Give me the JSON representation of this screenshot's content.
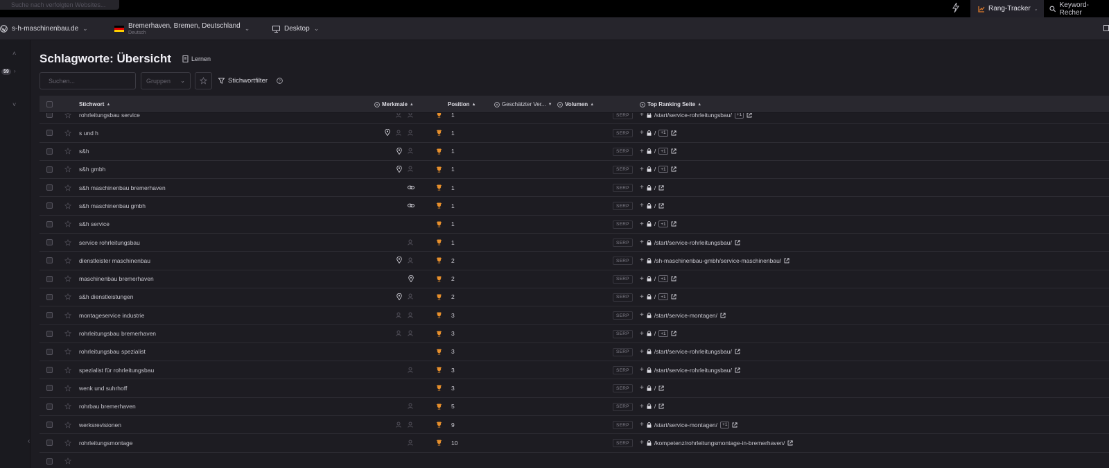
{
  "topbar": {
    "search_placeholder": "Suche nach verfolgten Websites...",
    "active_tab": "Rang-Tracker",
    "next_tab": "Keyword-Recher"
  },
  "project": {
    "domain": "s-h-maschinenbau.de",
    "location": "Bremerhaven, Bremen, Deutschland",
    "language": "Deutsch",
    "device": "Desktop"
  },
  "sidebar": {
    "badge": "59"
  },
  "page": {
    "title": "Schlagworte: Übersicht",
    "learn": "Lernen",
    "search_placeholder": "Suchen...",
    "groups_placeholder": "Gruppen",
    "keyword_filter": "Stichwortfilter"
  },
  "columns": {
    "keyword": "Stichwort",
    "features": "Merkmale",
    "position": "Position",
    "traffic": "Geschätzter Ver...",
    "volume": "Volumen",
    "top_page": "Top Ranking Seite"
  },
  "serp_label": "SERP",
  "plus_one_label": "+1",
  "colors": {
    "accent": "#e07b2a",
    "trophy": "#e8902c"
  },
  "rows": [
    {
      "keyword": "rohrleitungsbau service",
      "features": [
        "ghost",
        "ghost"
      ],
      "position": "1",
      "page": "/start/service-rohrleitungsbau/",
      "plus_one": true
    },
    {
      "keyword": "s und h",
      "features": [
        "pin",
        "ghost",
        "ghost"
      ],
      "position": "1",
      "page": "/",
      "plus_one": true
    },
    {
      "keyword": "s&h",
      "features": [
        "pin",
        "ghost"
      ],
      "position": "1",
      "page": "/",
      "plus_one": true
    },
    {
      "keyword": "s&h gmbh",
      "features": [
        "pin",
        "ghost"
      ],
      "position": "1",
      "page": "/",
      "plus_one": true
    },
    {
      "keyword": "s&h maschinenbau bremerhaven",
      "features": [
        "link"
      ],
      "position": "1",
      "page": "/",
      "plus_one": false
    },
    {
      "keyword": "s&h maschinenbau gmbh",
      "features": [
        "link"
      ],
      "position": "1",
      "page": "/",
      "plus_one": false
    },
    {
      "keyword": "s&h service",
      "features": [],
      "position": "1",
      "page": "/",
      "plus_one": true
    },
    {
      "keyword": "service rohrleitungsbau",
      "features": [
        "ghost"
      ],
      "position": "1",
      "page": "/start/service-rohrleitungsbau/",
      "plus_one": false
    },
    {
      "keyword": "dienstleister maschinenbau",
      "features": [
        "pin",
        "ghost"
      ],
      "position": "2",
      "page": "/sh-maschinenbau-gmbh/service-maschinenbau/",
      "plus_one": false
    },
    {
      "keyword": "maschinenbau bremerhaven",
      "features": [
        "pin"
      ],
      "position": "2",
      "page": "/",
      "plus_one": true
    },
    {
      "keyword": "s&h dienstleistungen",
      "features": [
        "pin",
        "ghost"
      ],
      "position": "2",
      "page": "/",
      "plus_one": true
    },
    {
      "keyword": "montageservice industrie",
      "features": [
        "ghost",
        "ghost"
      ],
      "position": "3",
      "page": "/start/service-montagen/",
      "plus_one": false
    },
    {
      "keyword": "rohrleitungsbau bremerhaven",
      "features": [
        "ghost",
        "ghost"
      ],
      "position": "3",
      "page": "/",
      "plus_one": true
    },
    {
      "keyword": "rohrleitungsbau spezialist",
      "features": [],
      "position": "3",
      "page": "/start/service-rohrleitungsbau/",
      "plus_one": false
    },
    {
      "keyword": "spezialist für rohrleitungsbau",
      "features": [
        "ghost"
      ],
      "position": "3",
      "page": "/start/service-rohrleitungsbau/",
      "plus_one": false
    },
    {
      "keyword": "wenk und suhrhoff",
      "features": [],
      "position": "3",
      "page": "/",
      "plus_one": false
    },
    {
      "keyword": "rohrbau bremerhaven",
      "features": [
        "ghost"
      ],
      "position": "5",
      "page": "/",
      "plus_one": false
    },
    {
      "keyword": "werksrevisionen",
      "features": [
        "ghost",
        "ghost"
      ],
      "position": "9",
      "page": "/start/service-montagen/",
      "plus_one": true
    },
    {
      "keyword": "rohrleitungsmontage",
      "features": [
        "ghost"
      ],
      "position": "10",
      "page": "/kompetenz/rohrleitungsmontage-in-bremerhaven/",
      "plus_one": false
    },
    {
      "keyword": "",
      "features": [],
      "position": "",
      "page": "",
      "plus_one": false
    }
  ]
}
